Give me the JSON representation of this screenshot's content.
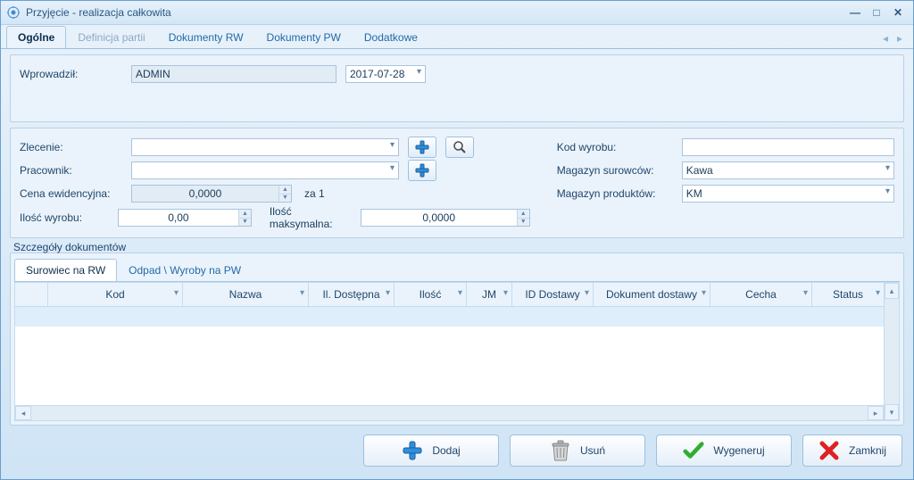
{
  "window": {
    "title": "Przyjęcie - realizacja całkowita"
  },
  "tabs": {
    "items": [
      {
        "label": "Ogólne",
        "active": true
      },
      {
        "label": "Definicja partii",
        "disabled": true
      },
      {
        "label": "Dokumenty RW"
      },
      {
        "label": "Dokumenty PW"
      },
      {
        "label": "Dodatkowe"
      }
    ]
  },
  "form": {
    "wprowadzil_label": "Wprowadził:",
    "wprowadzil_value": "ADMIN",
    "data_value": "2017-07-28",
    "zlecenie_label": "Zlecenie:",
    "zlecenie_value": "",
    "pracownik_label": "Pracownik:",
    "pracownik_value": "",
    "cena_label": "Cena ewidencyjna:",
    "cena_value": "0,0000",
    "za1_label": "za 1",
    "ilosc_wyrobu_label": "Ilość wyrobu:",
    "ilosc_wyrobu_value": "0,00",
    "ilosc_max_label": "Ilość maksymalna:",
    "ilosc_max_value": "0,0000",
    "kod_wyrobu_label": "Kod wyrobu:",
    "kod_wyrobu_value": "",
    "mag_surowcow_label": "Magazyn surowców:",
    "mag_surowcow_value": "Kawa",
    "mag_produktow_label": "Magazyn produktów:",
    "mag_produktow_value": "KM"
  },
  "details": {
    "group_title": "Szczegóły dokumentów",
    "subtabs": [
      {
        "label": "Surowiec na RW",
        "active": true
      },
      {
        "label": "Odpad \\ Wyroby na PW"
      }
    ],
    "columns": [
      {
        "label": "",
        "width": 36
      },
      {
        "label": "Kod",
        "width": 150
      },
      {
        "label": "Nazwa",
        "width": 140
      },
      {
        "label": "Il. Dostępna",
        "width": 95
      },
      {
        "label": "Ilość",
        "width": 80
      },
      {
        "label": "JM",
        "width": 50
      },
      {
        "label": "ID Dostawy",
        "width": 90
      },
      {
        "label": "Dokument dostawy",
        "width": 130
      },
      {
        "label": "Cecha",
        "width": 145
      },
      {
        "label": "Status",
        "width": 80
      }
    ]
  },
  "buttons": {
    "dodaj": "Dodaj",
    "usun": "Usuń",
    "wygeneruj": "Wygeneruj",
    "zamknij": "Zamknij"
  },
  "icons": {
    "plus": "plus-icon",
    "search": "search-icon",
    "trash": "trash-icon",
    "check": "check-icon",
    "cross": "cross-icon"
  }
}
